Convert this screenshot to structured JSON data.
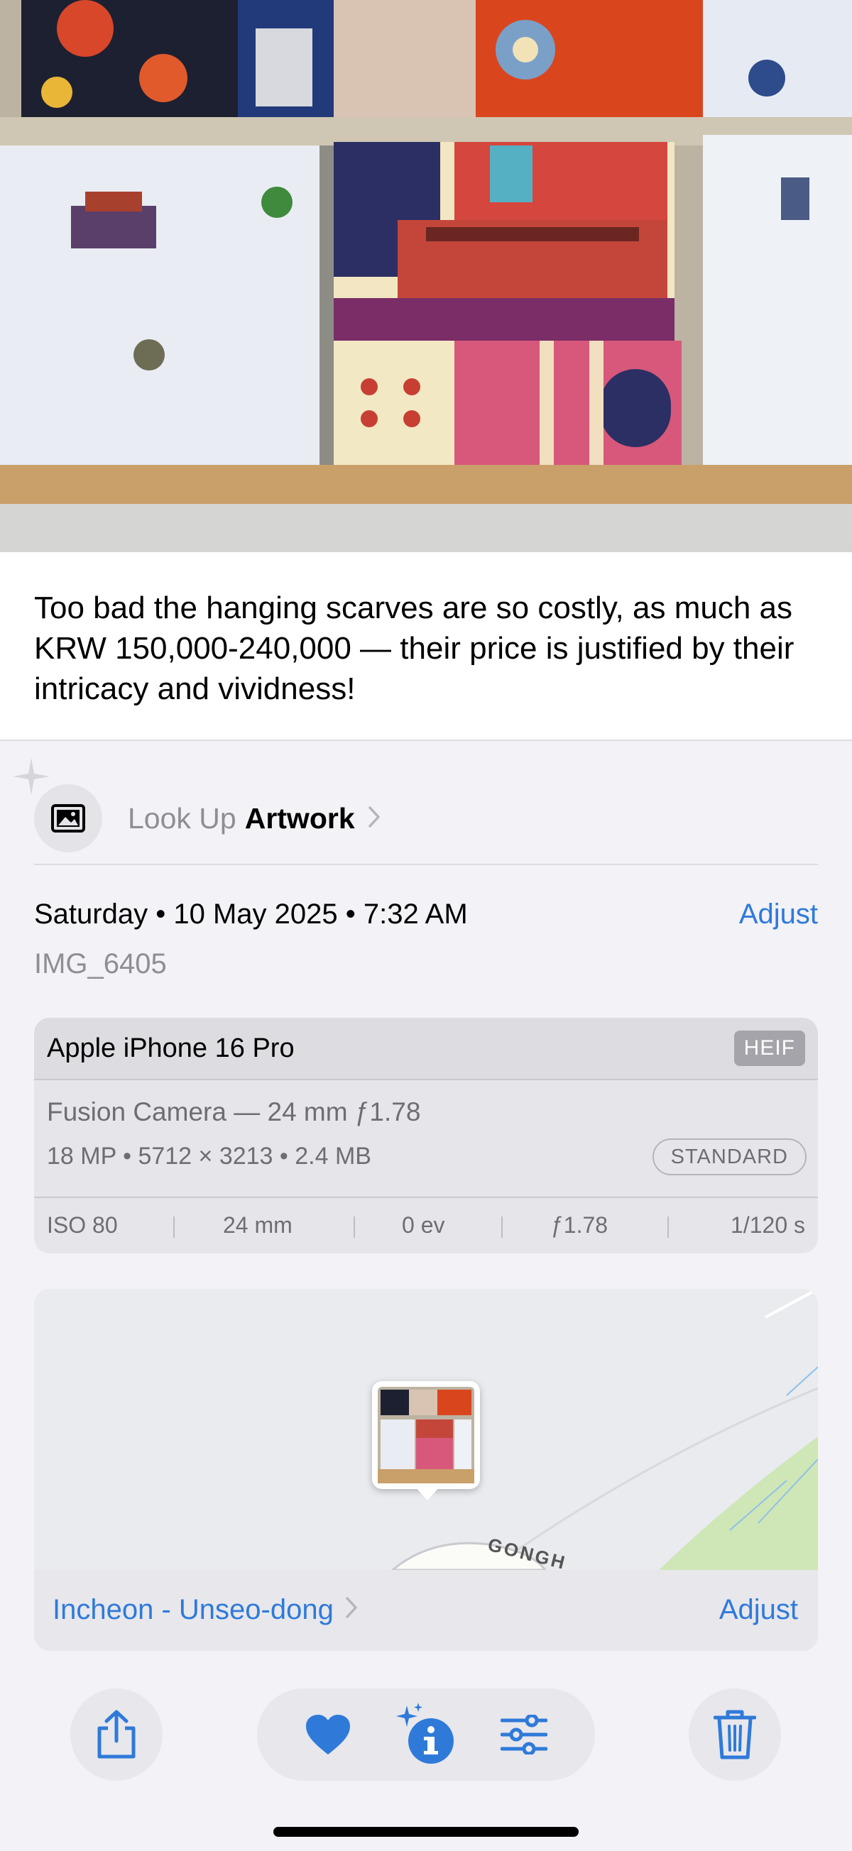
{
  "caption": "Too bad the hanging scarves are so costly, as much as KRW 150,000-240,000 — their price is justified by their intricacy and vividness!",
  "lookup": {
    "prefix": "Look Up",
    "subject": "Artwork",
    "chevron": ">"
  },
  "datetime": {
    "day": "Saturday",
    "date": "10 May 2025",
    "time": "7:32 AM",
    "separator": "•",
    "adjust_label": "Adjust"
  },
  "filename": "IMG_6405",
  "camera": {
    "model": "Apple iPhone 16 Pro",
    "format": "HEIF",
    "lens": "Fusion Camera — 24 mm ƒ1.78",
    "specs": "18 MP  •  5712 × 3213  •  2.4 MB",
    "mode": "STANDARD",
    "exif": [
      "ISO 80",
      "24 mm",
      "0 ev",
      "ƒ1.78",
      "1/120 s"
    ]
  },
  "map": {
    "location": "Incheon - Unseo-dong",
    "chevron": ">",
    "adjust_label": "Adjust",
    "road_label": "GONGH"
  },
  "toolbar": {
    "icons": [
      "share-icon",
      "heart-icon",
      "info-sparkle-icon",
      "adjust-sliders-icon",
      "trash-icon"
    ],
    "accent": "#2f7ad9"
  }
}
